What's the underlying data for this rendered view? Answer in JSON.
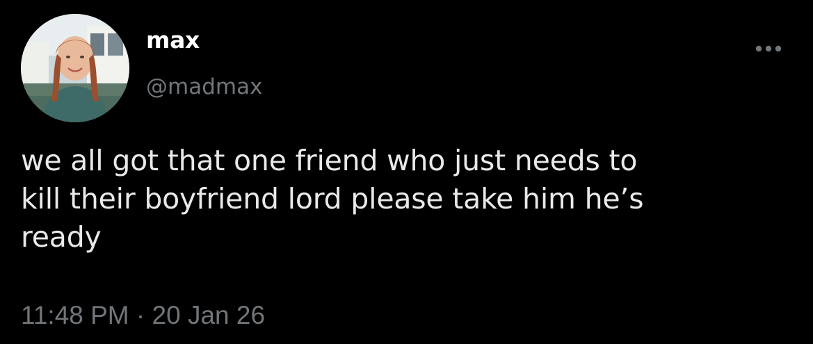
{
  "tweet": {
    "author": {
      "display_name": "max",
      "handle": "@madmax"
    },
    "text": "we all got that one friend who just needs to\nkill their boyfriend lord please take him he’s\nready",
    "time": "11:48 PM",
    "separator": " · ",
    "date": "20 Jan 26"
  },
  "icons": {
    "more": "more-options-icon",
    "avatar": "profile-photo"
  },
  "colors": {
    "background": "#000000",
    "primary_text": "#e7e9ea",
    "secondary_text": "#71767b"
  }
}
